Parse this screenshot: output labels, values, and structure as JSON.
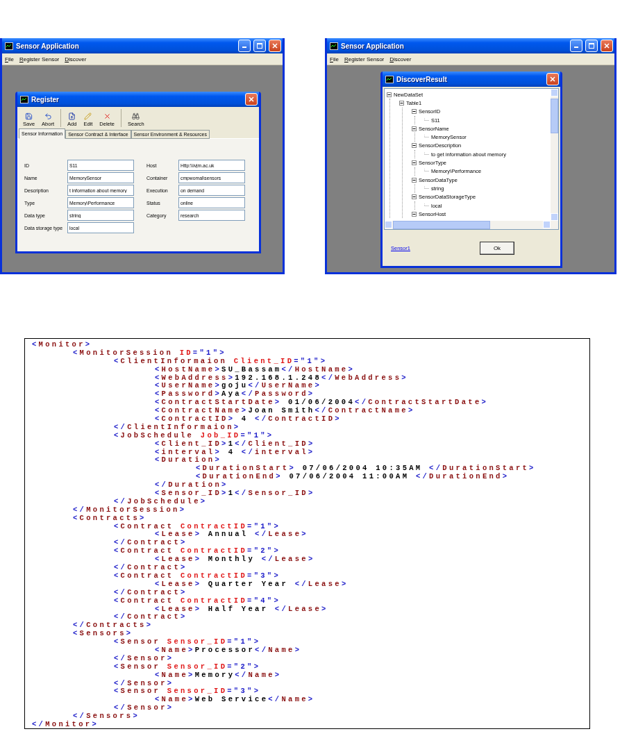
{
  "register_window": {
    "title": "Sensor Application",
    "menu": [
      "File",
      "Register Sensor",
      "Discover"
    ],
    "dialog": {
      "title": "Register",
      "toolbar_groups": [
        [
          {
            "label": "Save",
            "kind": "save"
          },
          {
            "label": "Abort",
            "kind": "undo"
          }
        ],
        [
          {
            "label": "Add",
            "kind": "add"
          },
          {
            "label": "Edit",
            "kind": "edit"
          },
          {
            "label": "Delete",
            "kind": "delete"
          }
        ],
        [
          {
            "label": "Search",
            "kind": "search"
          }
        ]
      ],
      "tabs": [
        {
          "label": "Sensor Information",
          "selected": true
        },
        {
          "label": "Sensor Contract & Interface",
          "selected": false
        },
        {
          "label": "Sensor Environment & Resources",
          "selected": false
        }
      ],
      "fields_left": [
        {
          "label": "ID",
          "value": "S11"
        },
        {
          "label": "Name",
          "value": "MemorySensor"
        },
        {
          "label": "Description",
          "value": "t information about memory"
        },
        {
          "label": "Type",
          "value": "Memory\\Performance"
        },
        {
          "label": "Data type",
          "value": "string"
        },
        {
          "label": "Data storage type",
          "value": "local"
        }
      ],
      "fields_right": [
        {
          "label": "Host",
          "value": "Http:\\\\ivjm.ac.uk"
        },
        {
          "label": "Container",
          "value": "cmpwomal\\sensors"
        },
        {
          "label": "Execution",
          "value": "on demand"
        },
        {
          "label": "Status",
          "value": "online"
        },
        {
          "label": "Category",
          "value": "research"
        }
      ]
    }
  },
  "discover_window": {
    "title": "Sensor Application",
    "menu": [
      "File",
      "Register Sensor",
      "Discover"
    ],
    "dialog": {
      "title": "DiscoverResult",
      "tree": [
        {
          "label": "NewDataSet",
          "expanded": true,
          "children": [
            {
              "label": "Table1",
              "expanded": true,
              "children": [
                {
                  "label": "SensorID",
                  "expanded": true,
                  "children": [
                    {
                      "label": "S11"
                    }
                  ]
                },
                {
                  "label": "SensorName",
                  "expanded": true,
                  "children": [
                    {
                      "label": "MemorySensor"
                    }
                  ]
                },
                {
                  "label": "SensorDescription",
                  "expanded": true,
                  "children": [
                    {
                      "label": "to get information about memory"
                    }
                  ]
                },
                {
                  "label": "SensorType",
                  "expanded": true,
                  "children": [
                    {
                      "label": "Memory\\Performance"
                    }
                  ]
                },
                {
                  "label": "SensorDataType",
                  "expanded": true,
                  "children": [
                    {
                      "label": "string"
                    }
                  ]
                },
                {
                  "label": "SensorDataStorageType",
                  "expanded": true,
                  "children": [
                    {
                      "label": "local"
                    }
                  ]
                },
                {
                  "label": "SensorHost",
                  "expanded": true
                }
              ]
            }
          ]
        }
      ],
      "link": "Sensor1",
      "button": "Ok"
    }
  },
  "xml_listing": [
    {
      "open": "<Monitor>",
      "close": "</Monitor>",
      "children": [
        {
          "open": "<MonitorSession ID=\"1\">",
          "close": "</MonitorSession>",
          "children": [
            {
              "open": "<ClientInformaion Client_ID=\"1\">",
              "close": "</ClientInformaion>",
              "children": [
                {
                  "line": "<HostName>SU_Bassam</HostName>"
                },
                {
                  "line": "<WebAddress>192.168.1.248</WebAddress>"
                },
                {
                  "line": "<UserName>goju</UserName>"
                },
                {
                  "line": "<Password>Aya</Password>"
                },
                {
                  "line": "<ContractStartDate> 01/06/2004</ContractStartDate>"
                },
                {
                  "line": "<ContractName>Joan Smith</ContractName>"
                },
                {
                  "line": "<ContractID> 4 </ContractID>"
                }
              ]
            },
            {
              "open": "<JobSchedule Job_ID=\"1\">",
              "close": "</JobSchedule>",
              "children": [
                {
                  "line": "<Client_ID>1</Client_ID>"
                },
                {
                  "line": "<interval> 4 </interval>"
                },
                {
                  "open": "<Duration>",
                  "close": "</Duration>",
                  "children": [
                    {
                      "line": "<DurationStart> 07/06/2004 10:35AM </DurationStart>"
                    },
                    {
                      "line": "<DurationEnd> 07/06/2004 11:00AM </DurationEnd>"
                    }
                  ]
                },
                {
                  "line": "<Sensor_ID>1</Sensor_ID>"
                }
              ]
            }
          ]
        },
        {
          "open": "<Contracts>",
          "close": "</Contracts>",
          "children": [
            {
              "open": "<Contract ContractID=\"1\">",
              "close": "</Contract>",
              "children": [
                {
                  "line": "<Lease> Annual </Lease>"
                }
              ]
            },
            {
              "open": "<Contract ContractID=\"2\">",
              "close": "</Contract>",
              "children": [
                {
                  "line": "<Lease> Monthly </Lease>"
                }
              ]
            },
            {
              "open": "<Contract ContractID=\"3\">",
              "close": "</Contract>",
              "children": [
                {
                  "line": "<Lease> Quarter Year </Lease>"
                }
              ]
            },
            {
              "open": "<Contract ContractID=\"4\">",
              "close": "</Contract>",
              "children": [
                {
                  "line": "<Lease> Half Year </Lease>"
                }
              ]
            }
          ]
        },
        {
          "open": "<Sensors>",
          "close": "</Sensors>",
          "children": [
            {
              "open": "<Sensor Sensor_ID=\"1\">",
              "close": "</Sensor>",
              "children": [
                {
                  "line": "<Name>Processor</Name>"
                }
              ]
            },
            {
              "open": "<Sensor Sensor_ID=\"2\">",
              "close": "</Sensor>",
              "children": [
                {
                  "line": "<Name>Memory</Name>"
                }
              ]
            },
            {
              "open": "<Sensor Sensor_ID=\"3\">",
              "close": "</Sensor>",
              "children": [
                {
                  "line": "<Name>Web Service</Name>"
                }
              ]
            }
          ]
        }
      ]
    }
  ]
}
